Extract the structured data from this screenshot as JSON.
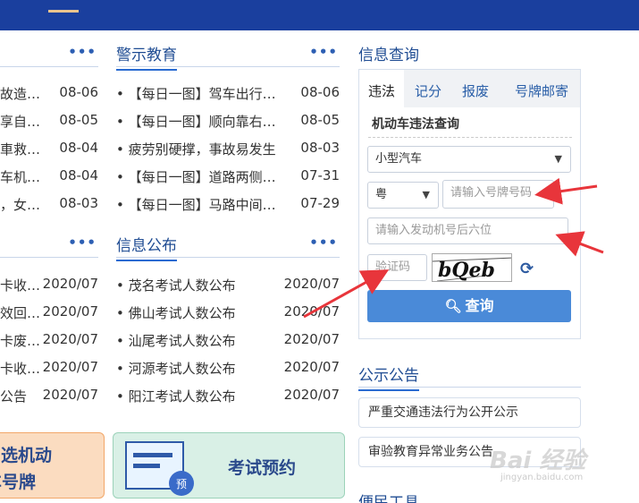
{
  "left_column": {
    "list_a": [
      {
        "title": "故造…",
        "date": "08-06"
      },
      {
        "title": "享自…",
        "date": "08-05"
      },
      {
        "title": "車救…",
        "date": "08-04"
      },
      {
        "title": "车机…",
        "date": "08-04"
      },
      {
        "title": "，女…",
        "date": "08-03"
      }
    ],
    "list_b": [
      {
        "title": "卡收…",
        "date": "2020/07"
      },
      {
        "title": "效回…",
        "date": "2020/07"
      },
      {
        "title": "卡废…",
        "date": "2020/07"
      },
      {
        "title": "卡收…",
        "date": "2020/07"
      },
      {
        "title": "公告",
        "date": "2020/07"
      }
    ],
    "card_line1": "选机动",
    "card_line2": "车号牌"
  },
  "warning": {
    "title": "警示教育",
    "more": "•••",
    "items": [
      {
        "title": "• 【每日一图】驾车出行…",
        "date": "08-06"
      },
      {
        "title": "• 【每日一图】顺向靠右…",
        "date": "08-05"
      },
      {
        "title": "• 疲劳别硬撑，事故易发生",
        "date": "08-03"
      },
      {
        "title": "• 【每日一图】道路两侧…",
        "date": "07-31"
      },
      {
        "title": "• 【每日一图】马路中间…",
        "date": "07-29"
      }
    ]
  },
  "info_publish": {
    "title": "信息公布",
    "more": "•••",
    "items": [
      {
        "title": "• 茂名考试人数公布",
        "date": "2020/07"
      },
      {
        "title": "• 佛山考试人数公布",
        "date": "2020/07"
      },
      {
        "title": "• 汕尾考试人数公布",
        "date": "2020/07"
      },
      {
        "title": "• 河源考试人数公布",
        "date": "2020/07"
      },
      {
        "title": "• 阳江考试人数公布",
        "date": "2020/07"
      }
    ]
  },
  "left_more": "•••",
  "exam_card_label": "考试预约",
  "exam_badge": "预",
  "query": {
    "title": "信息查询",
    "tabs": [
      "违法",
      "记分",
      "报废",
      "号牌邮寄"
    ],
    "subtitle": "机动车违法查询",
    "vehicle_type": "小型汽车",
    "province": "粤",
    "plate_placeholder": "请输入号牌号码",
    "engine_placeholder": "请输入发动机号后六位",
    "captcha_placeholder": "验证码",
    "captcha_text": "bQeb",
    "refresh_icon": "refresh-icon",
    "button_label": "查询",
    "search_icon": "search-icon"
  },
  "notice": {
    "title": "公示公告",
    "items": [
      "严重交通违法行为公开公示",
      "审验教育异常业务公告"
    ]
  },
  "convenience_title": "便民工具",
  "watermark": {
    "brand": "Bai 经验",
    "sub": "jingyan.baidu.com"
  },
  "colors": {
    "topbar": "#1a3f9e",
    "accent": "#2a6bd1",
    "button": "#4a8ad8",
    "arrow": "#e8353b"
  }
}
